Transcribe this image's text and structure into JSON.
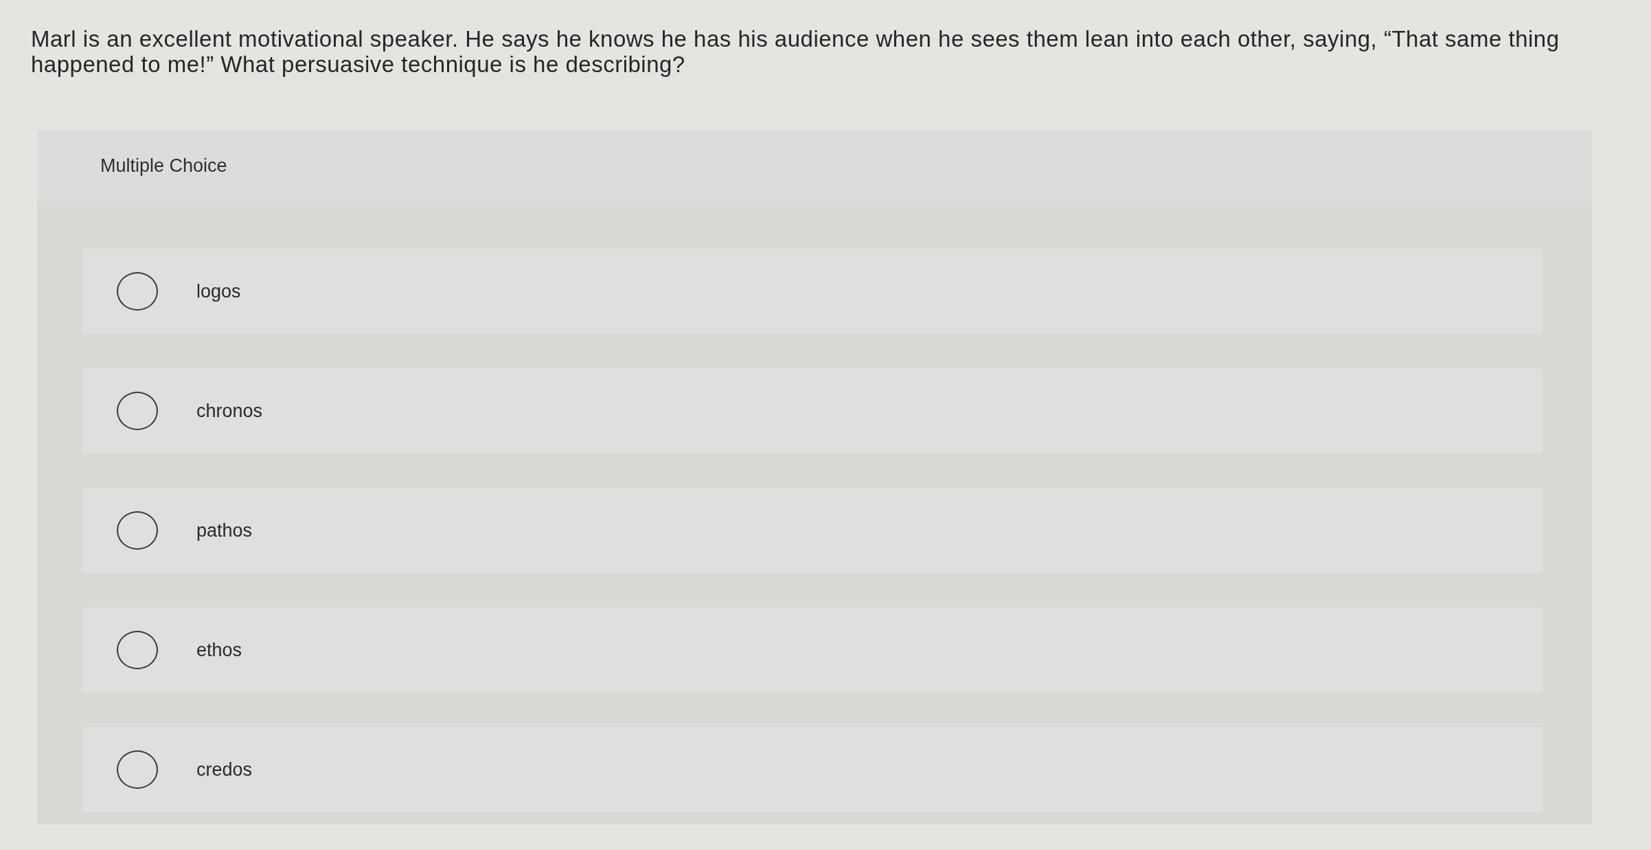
{
  "question": "Marl is an excellent motivational speaker. He says he knows he has his audience when he sees them lean into each other, saying, “That same thing happened to me!” What persuasive technique is he describing?",
  "question_type": "Multiple Choice",
  "options": [
    {
      "label": "logos",
      "selected": false
    },
    {
      "label": "chronos",
      "selected": false
    },
    {
      "label": "pathos",
      "selected": false
    },
    {
      "label": "ethos",
      "selected": false
    },
    {
      "label": "credos",
      "selected": false
    }
  ]
}
